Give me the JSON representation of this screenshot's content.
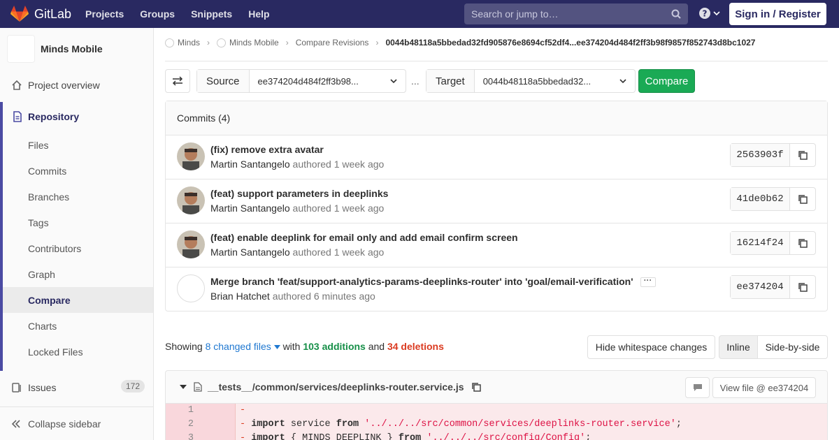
{
  "topbar": {
    "brand": "GitLab",
    "nav": [
      "Projects",
      "Groups",
      "Snippets",
      "Help"
    ],
    "search_placeholder": "Search or jump to…",
    "signin": "Sign in / Register"
  },
  "sidebar": {
    "project_name": "Minds Mobile",
    "overview": "Project overview",
    "repository": "Repository",
    "sub_items": [
      "Files",
      "Commits",
      "Branches",
      "Tags",
      "Contributors",
      "Graph",
      "Compare",
      "Charts",
      "Locked Files"
    ],
    "issues": "Issues",
    "issues_count": "172",
    "collapse": "Collapse sidebar"
  },
  "breadcrumb": {
    "items": [
      "Minds",
      "Minds Mobile",
      "Compare Revisions"
    ],
    "current": "0044b48118a5bbedad32fd905876e8694cf52df4...ee374204d484f2ff3b98f9857f852743d8bc1027"
  },
  "compare_bar": {
    "source_label": "Source",
    "source_value": "ee374204d484f2ff3b98...",
    "dots": "...",
    "target_label": "Target",
    "target_value": "0044b48118a5bbedad32...",
    "compare_button": "Compare"
  },
  "commits": {
    "header": "Commits (4)",
    "items": [
      {
        "title": "(fix) remove extra avatar",
        "author": "Martin Santangelo",
        "meta": "authored 1 week ago",
        "sha": "2563903f"
      },
      {
        "title": "(feat) support parameters in deeplinks",
        "author": "Martin Santangelo",
        "meta": "authored 1 week ago",
        "sha": "41de0b62"
      },
      {
        "title": "(feat) enable deeplink for email only and add email confirm screen",
        "author": "Martin Santangelo",
        "meta": "authored 1 week ago",
        "sha": "16214f24"
      },
      {
        "title": "Merge branch 'feat/support-analytics-params-deeplinks-router' into 'goal/email-verification'",
        "author": "Brian Hatchet",
        "meta": "authored 6 minutes ago",
        "sha": "ee374204"
      }
    ]
  },
  "stats": {
    "showing": "Showing",
    "changed": "8 changed files",
    "with": "with",
    "additions": "103 additions",
    "and": "and",
    "deletions": "34 deletions"
  },
  "view_controls": {
    "whitespace": "Hide whitespace changes",
    "inline": "Inline",
    "side_by_side": "Side-by-side"
  },
  "file": {
    "name": "__tests__/common/services/deeplinks-router.service.js",
    "view_file": "View file @ ee374204",
    "lines": [
      {
        "num": "1",
        "text": ""
      },
      {
        "num": "2",
        "kw1": "import",
        "mid": " service ",
        "kw2": "from",
        "str": " '../../../src/common/services/deeplinks-router.service'",
        "end": ";"
      },
      {
        "num": "3",
        "kw1": "import",
        "mid": " { MINDS_DEEPLINK } ",
        "kw2": "from",
        "str": " '../../../src/config/Config'",
        "end": ";"
      }
    ]
  }
}
